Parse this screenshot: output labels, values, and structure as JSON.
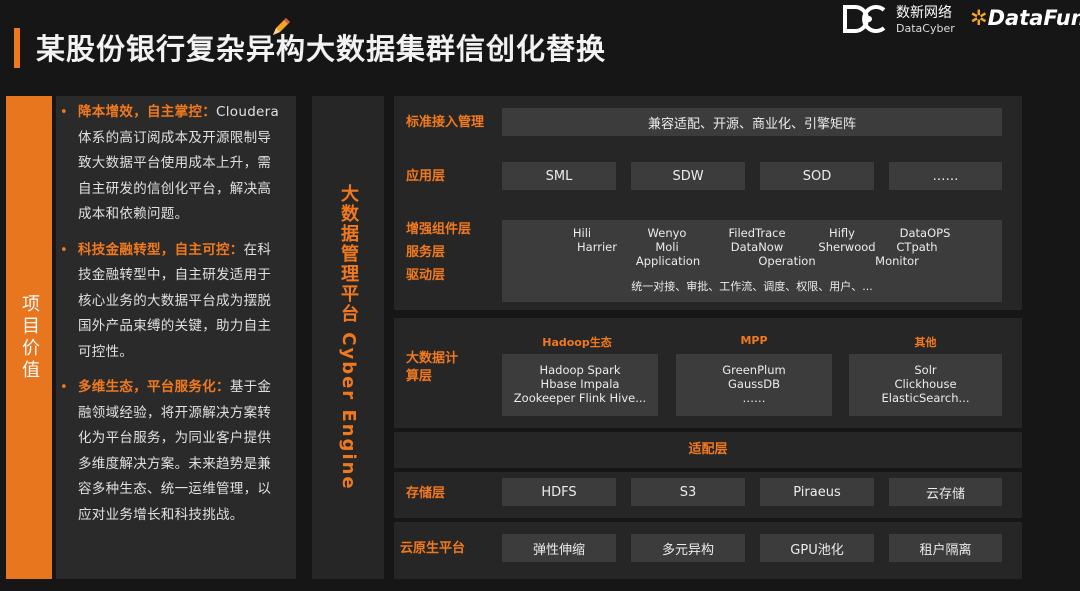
{
  "header": {
    "title": "某股份银行复杂异构大数据集群信创化替换",
    "logo_datacyber_cn": "数新网络",
    "logo_datacyber_en": "DataCyber",
    "logo_datafun": "DataFun."
  },
  "left_tab": {
    "label": "项目价值"
  },
  "values": [
    {
      "head": "降本增效，自主掌控：",
      "body": "Cloudera体系的高订阅成本及开源限制导致大数据平台使用成本上升，需自主研发的信创化平台，解决高成本和依赖问题。"
    },
    {
      "head": "科技金融转型，自主可控：",
      "body": "在科技金融转型中，自主研发适用于核心业务的大数据平台成为摆脱国外产品束缚的关键，助力自主可控性。"
    },
    {
      "head": "多维生态，平台服务化：",
      "body": "基于金融领域经验，将开源解决方案转化为平台服务，为同业客户提供多维度解决方案。未来趋势是兼容多种生态、统一运维管理，以应对业务增长和科技挑战。"
    }
  ],
  "middle": {
    "label": "大数据管理平台 Cyber Engine"
  },
  "arch": {
    "standard_access": {
      "label": "标准接入管理",
      "content": "兼容适配、开源、商业化、引擎矩阵"
    },
    "application": {
      "label": "应用层",
      "items": [
        "SML",
        "SDW",
        "SOD",
        "……"
      ]
    },
    "enhance": {
      "labels": [
        "增强组件层",
        "服务层",
        "驱动层"
      ],
      "row1": [
        "Hili",
        "Wenyo",
        "FiledTrace",
        "Hifly",
        "DataOPS"
      ],
      "row2": [
        "Harrier",
        "Moli",
        "DataNow",
        "Sherwood",
        "CTpath"
      ],
      "row3": [
        "Application",
        "Operation",
        "Monitor"
      ],
      "footer": "统一对接、审批、工作流、调度、权限、用户、..."
    },
    "compute": {
      "label": "大数据计算层",
      "groups": [
        {
          "head": "Hadoop生态",
          "lines": [
            "Hadoop  Spark",
            "Hbase  Impala",
            "Zookeeper  Flink  Hive..."
          ]
        },
        {
          "head": "MPP",
          "lines": [
            "GreenPlum",
            "GaussDB",
            "……"
          ]
        },
        {
          "head": "其他",
          "lines": [
            "Solr",
            "Clickhouse",
            "ElasticSearch..."
          ]
        }
      ]
    },
    "adapt": {
      "label": "适配层"
    },
    "storage": {
      "label": "存储层",
      "items": [
        "HDFS",
        "S3",
        "Piraeus",
        "云存储"
      ]
    },
    "cloud": {
      "label": "云原生平台",
      "items": [
        "弹性伸缩",
        "多元异构",
        "GPU池化",
        "租户隔离"
      ]
    }
  }
}
